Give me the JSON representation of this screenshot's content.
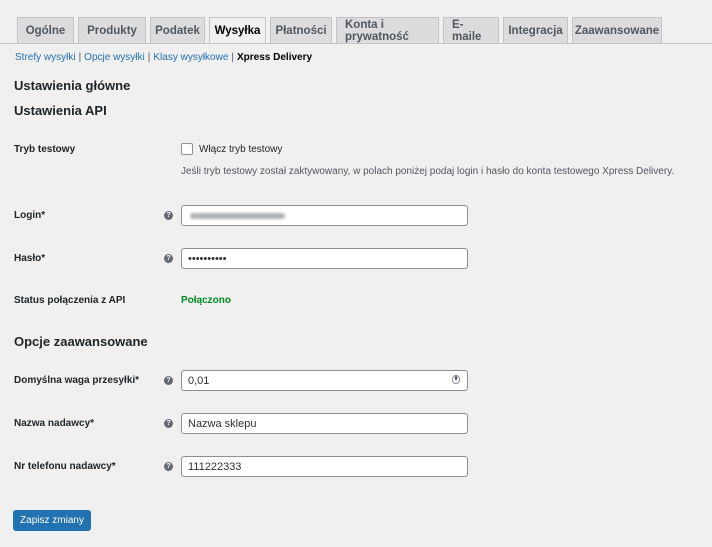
{
  "tabs": [
    {
      "label": "Ogólne",
      "active": false
    },
    {
      "label": "Produkty",
      "active": false
    },
    {
      "label": "Podatek",
      "active": false
    },
    {
      "label": "Wysyłka",
      "active": true
    },
    {
      "label": "Płatności",
      "active": false
    },
    {
      "label": "Konta i prywatność",
      "active": false
    },
    {
      "label": "E-maile",
      "active": false
    },
    {
      "label": "Integracja",
      "active": false
    },
    {
      "label": "Zaawansowane",
      "active": false
    }
  ],
  "subnav": {
    "items": [
      "Strefy wysyłki",
      "Opcje wysyłki",
      "Klasy wysyłkowe"
    ],
    "current": "Xpress Delivery",
    "separator": "|"
  },
  "sections": {
    "main_settings": "Ustawienia główne",
    "api_settings": "Ustawienia API",
    "advanced_options": "Opcje zaawansowane"
  },
  "fields": {
    "test_mode": {
      "label": "Tryb testowy",
      "checkbox_label": "Włącz tryb testowy",
      "checked": false,
      "description": "Jeśli tryb testowy został zaktywowany, w polach poniżej podaj login i hasło do konta testowego Xpress Delivery."
    },
    "login": {
      "label": "Login*"
    },
    "password": {
      "label": "Hasło*",
      "value": "••••••••••"
    },
    "api_status": {
      "label": "Status połączenia z API",
      "value": "Połączono"
    },
    "default_weight": {
      "label": "Domyślna waga przesyłki*",
      "value": "0,01"
    },
    "sender_name": {
      "label": "Nazwa nadawcy*",
      "value": "Nazwa sklepu"
    },
    "sender_phone": {
      "label": "Nr telefonu nadawcy*",
      "value": "111222333"
    }
  },
  "help_icon_glyph": "?",
  "save_button": {
    "label": "Zapisz zmiany"
  },
  "colors": {
    "primary": "#2271b1",
    "success": "#008a20",
    "background": "#f0f0f1"
  }
}
